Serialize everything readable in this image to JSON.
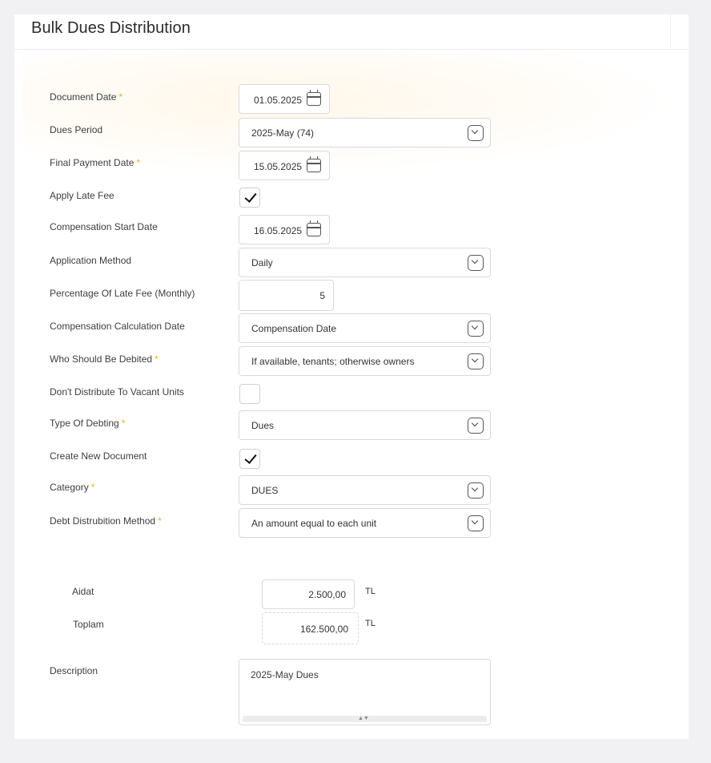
{
  "header": {
    "title": "Bulk Dues Distribution"
  },
  "form": {
    "document_date": {
      "label": "Document Date",
      "required": "*",
      "value": "01.05.2025",
      "icon": "calendar-icon"
    },
    "dues_period": {
      "label": "Dues Period",
      "value": "2025-May (74)",
      "icon": "chevron-down-icon"
    },
    "final_payment_date": {
      "label": "Final Payment Date",
      "required": "*",
      "value": "15.05.2025",
      "icon": "calendar-icon"
    },
    "apply_late_fee": {
      "label": "Apply Late Fee",
      "checked": true
    },
    "compensation_start_date": {
      "label": "Compensation Start Date",
      "value": "16.05.2025",
      "icon": "calendar-icon"
    },
    "application_method": {
      "label": "Application Method",
      "value": "Daily",
      "icon": "chevron-down-icon"
    },
    "late_fee_percentage": {
      "label": "Percentage Of Late Fee (Monthly)",
      "value": "5"
    },
    "compensation_calc_date": {
      "label": "Compensation Calculation Date",
      "value": "Compensation Date",
      "icon": "chevron-down-icon"
    },
    "who_debited": {
      "label": "Who Should Be Debited",
      "required": "*",
      "value": "If available, tenants; otherwise owners",
      "icon": "chevron-down-icon"
    },
    "dont_distribute_vacant": {
      "label": "Don't Distribute To Vacant Units",
      "checked": false
    },
    "type_of_debting": {
      "label": "Type Of Debting",
      "required": "*",
      "value": "Dues",
      "icon": "chevron-down-icon"
    },
    "create_new_document": {
      "label": "Create New Document",
      "checked": true
    },
    "category": {
      "label": "Category",
      "required": "*",
      "value": "DUES",
      "icon": "chevron-down-icon"
    },
    "debt_distribution_method": {
      "label": "Debt Distrubition Method",
      "required": "*",
      "value": "An amount equal to each unit",
      "icon": "chevron-down-icon"
    }
  },
  "amounts": {
    "aidat": {
      "label": "Aidat",
      "value": "2.500,00",
      "unit": "TL"
    },
    "toplam": {
      "label": "Toplam",
      "value": "162.500,00",
      "unit": "TL"
    }
  },
  "description": {
    "label": "Description",
    "value": "2025-May Dues"
  },
  "colors": {
    "required_star": "#f5b400",
    "border": "#d9d9de",
    "page_bg": "#f1f1f4"
  }
}
